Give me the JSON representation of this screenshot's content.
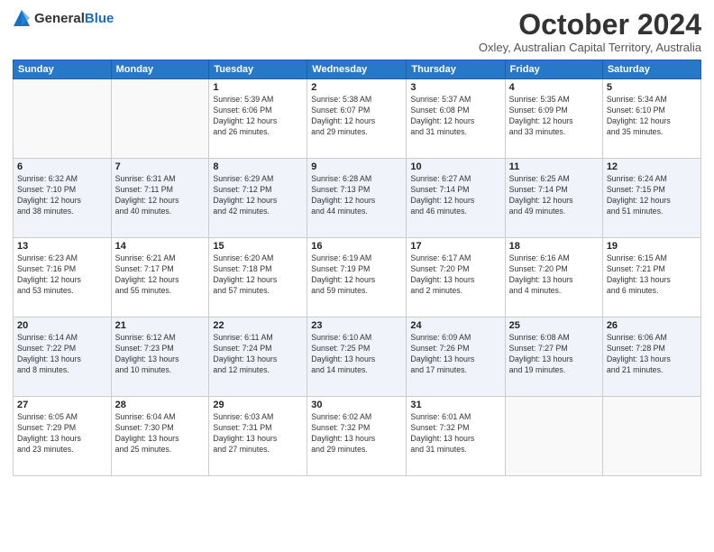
{
  "logo": {
    "text_general": "General",
    "text_blue": "Blue"
  },
  "header": {
    "month_title": "October 2024",
    "subtitle": "Oxley, Australian Capital Territory, Australia"
  },
  "days_of_week": [
    "Sunday",
    "Monday",
    "Tuesday",
    "Wednesday",
    "Thursday",
    "Friday",
    "Saturday"
  ],
  "weeks": [
    [
      {
        "day": "",
        "info": ""
      },
      {
        "day": "",
        "info": ""
      },
      {
        "day": "1",
        "info": "Sunrise: 5:39 AM\nSunset: 6:06 PM\nDaylight: 12 hours\nand 26 minutes."
      },
      {
        "day": "2",
        "info": "Sunrise: 5:38 AM\nSunset: 6:07 PM\nDaylight: 12 hours\nand 29 minutes."
      },
      {
        "day": "3",
        "info": "Sunrise: 5:37 AM\nSunset: 6:08 PM\nDaylight: 12 hours\nand 31 minutes."
      },
      {
        "day": "4",
        "info": "Sunrise: 5:35 AM\nSunset: 6:09 PM\nDaylight: 12 hours\nand 33 minutes."
      },
      {
        "day": "5",
        "info": "Sunrise: 5:34 AM\nSunset: 6:10 PM\nDaylight: 12 hours\nand 35 minutes."
      }
    ],
    [
      {
        "day": "6",
        "info": "Sunrise: 6:32 AM\nSunset: 7:10 PM\nDaylight: 12 hours\nand 38 minutes."
      },
      {
        "day": "7",
        "info": "Sunrise: 6:31 AM\nSunset: 7:11 PM\nDaylight: 12 hours\nand 40 minutes."
      },
      {
        "day": "8",
        "info": "Sunrise: 6:29 AM\nSunset: 7:12 PM\nDaylight: 12 hours\nand 42 minutes."
      },
      {
        "day": "9",
        "info": "Sunrise: 6:28 AM\nSunset: 7:13 PM\nDaylight: 12 hours\nand 44 minutes."
      },
      {
        "day": "10",
        "info": "Sunrise: 6:27 AM\nSunset: 7:14 PM\nDaylight: 12 hours\nand 46 minutes."
      },
      {
        "day": "11",
        "info": "Sunrise: 6:25 AM\nSunset: 7:14 PM\nDaylight: 12 hours\nand 49 minutes."
      },
      {
        "day": "12",
        "info": "Sunrise: 6:24 AM\nSunset: 7:15 PM\nDaylight: 12 hours\nand 51 minutes."
      }
    ],
    [
      {
        "day": "13",
        "info": "Sunrise: 6:23 AM\nSunset: 7:16 PM\nDaylight: 12 hours\nand 53 minutes."
      },
      {
        "day": "14",
        "info": "Sunrise: 6:21 AM\nSunset: 7:17 PM\nDaylight: 12 hours\nand 55 minutes."
      },
      {
        "day": "15",
        "info": "Sunrise: 6:20 AM\nSunset: 7:18 PM\nDaylight: 12 hours\nand 57 minutes."
      },
      {
        "day": "16",
        "info": "Sunrise: 6:19 AM\nSunset: 7:19 PM\nDaylight: 12 hours\nand 59 minutes."
      },
      {
        "day": "17",
        "info": "Sunrise: 6:17 AM\nSunset: 7:20 PM\nDaylight: 13 hours\nand 2 minutes."
      },
      {
        "day": "18",
        "info": "Sunrise: 6:16 AM\nSunset: 7:20 PM\nDaylight: 13 hours\nand 4 minutes."
      },
      {
        "day": "19",
        "info": "Sunrise: 6:15 AM\nSunset: 7:21 PM\nDaylight: 13 hours\nand 6 minutes."
      }
    ],
    [
      {
        "day": "20",
        "info": "Sunrise: 6:14 AM\nSunset: 7:22 PM\nDaylight: 13 hours\nand 8 minutes."
      },
      {
        "day": "21",
        "info": "Sunrise: 6:12 AM\nSunset: 7:23 PM\nDaylight: 13 hours\nand 10 minutes."
      },
      {
        "day": "22",
        "info": "Sunrise: 6:11 AM\nSunset: 7:24 PM\nDaylight: 13 hours\nand 12 minutes."
      },
      {
        "day": "23",
        "info": "Sunrise: 6:10 AM\nSunset: 7:25 PM\nDaylight: 13 hours\nand 14 minutes."
      },
      {
        "day": "24",
        "info": "Sunrise: 6:09 AM\nSunset: 7:26 PM\nDaylight: 13 hours\nand 17 minutes."
      },
      {
        "day": "25",
        "info": "Sunrise: 6:08 AM\nSunset: 7:27 PM\nDaylight: 13 hours\nand 19 minutes."
      },
      {
        "day": "26",
        "info": "Sunrise: 6:06 AM\nSunset: 7:28 PM\nDaylight: 13 hours\nand 21 minutes."
      }
    ],
    [
      {
        "day": "27",
        "info": "Sunrise: 6:05 AM\nSunset: 7:29 PM\nDaylight: 13 hours\nand 23 minutes."
      },
      {
        "day": "28",
        "info": "Sunrise: 6:04 AM\nSunset: 7:30 PM\nDaylight: 13 hours\nand 25 minutes."
      },
      {
        "day": "29",
        "info": "Sunrise: 6:03 AM\nSunset: 7:31 PM\nDaylight: 13 hours\nand 27 minutes."
      },
      {
        "day": "30",
        "info": "Sunrise: 6:02 AM\nSunset: 7:32 PM\nDaylight: 13 hours\nand 29 minutes."
      },
      {
        "day": "31",
        "info": "Sunrise: 6:01 AM\nSunset: 7:32 PM\nDaylight: 13 hours\nand 31 minutes."
      },
      {
        "day": "",
        "info": ""
      },
      {
        "day": "",
        "info": ""
      }
    ]
  ]
}
